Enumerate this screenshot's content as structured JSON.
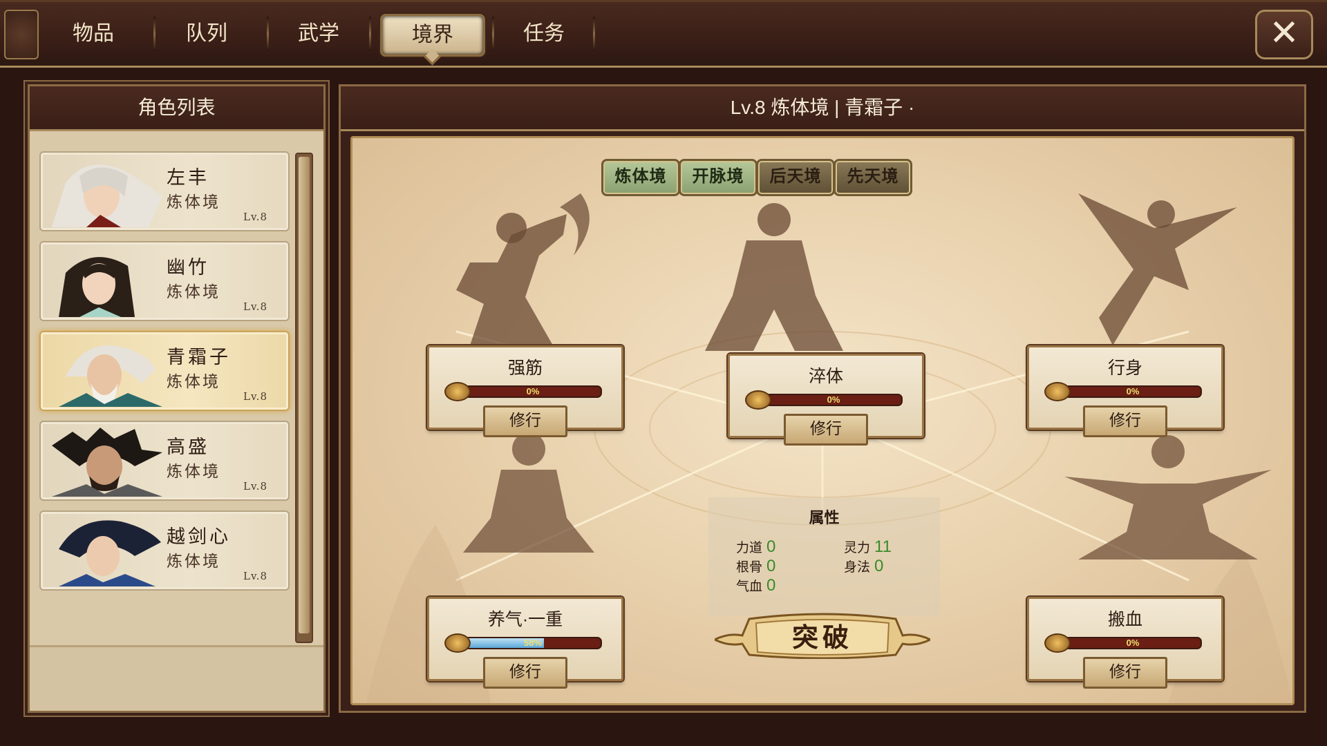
{
  "tabs": [
    {
      "label": "物品",
      "active": false
    },
    {
      "label": "队列",
      "active": false
    },
    {
      "label": "武学",
      "active": false
    },
    {
      "label": "境界",
      "active": true
    },
    {
      "label": "任务",
      "active": false
    }
  ],
  "close_glyph": "✕",
  "left_panel": {
    "title": "角色列表",
    "characters": [
      {
        "name": "左丰",
        "realm": "炼体境",
        "level": "Lv.8",
        "selected": false
      },
      {
        "name": "幽竹",
        "realm": "炼体境",
        "level": "Lv.8",
        "selected": false
      },
      {
        "name": "青霜子",
        "realm": "炼体境",
        "level": "Lv.8",
        "selected": true
      },
      {
        "name": "高盛",
        "realm": "炼体境",
        "level": "Lv.8",
        "selected": false
      },
      {
        "name": "越剑心",
        "realm": "炼体境",
        "level": "Lv.8",
        "selected": false
      }
    ]
  },
  "right_panel": {
    "header": "Lv.8   炼体境 | 青霜子 ·",
    "realm_buttons": [
      {
        "label": "炼体境",
        "unlocked": true
      },
      {
        "label": "开脉境",
        "unlocked": true
      },
      {
        "label": "后天境",
        "unlocked": false
      },
      {
        "label": "先天境",
        "unlocked": false
      }
    ],
    "training_nodes": [
      {
        "title": "强筋",
        "progress_text": "0%",
        "progress": 0,
        "button": "修行"
      },
      {
        "title": "淬体",
        "progress_text": "0%",
        "progress": 0,
        "button": "修行"
      },
      {
        "title": "行身",
        "progress_text": "0%",
        "progress": 0,
        "button": "修行"
      },
      {
        "title": "养气·一重",
        "progress_text": "58%",
        "progress": 0.58,
        "button": "修行"
      },
      {
        "title": "搬血",
        "progress_text": "0%",
        "progress": 0,
        "button": "修行"
      }
    ],
    "attributes": {
      "title": "属性",
      "items": [
        {
          "label": "力道",
          "value": "0"
        },
        {
          "label": "灵力",
          "value": "11"
        },
        {
          "label": "根骨",
          "value": "0"
        },
        {
          "label": "身法",
          "value": "0"
        },
        {
          "label": "气血",
          "value": "0"
        }
      ]
    },
    "breakthrough_label": "突破"
  },
  "colors": {
    "panel_dark": "#3a1f17",
    "parchment": "#e9d2ae",
    "gold_border": "#a88a5c",
    "attr_value": "#3a8a2a",
    "progress_fill": "#5aa8d8"
  }
}
